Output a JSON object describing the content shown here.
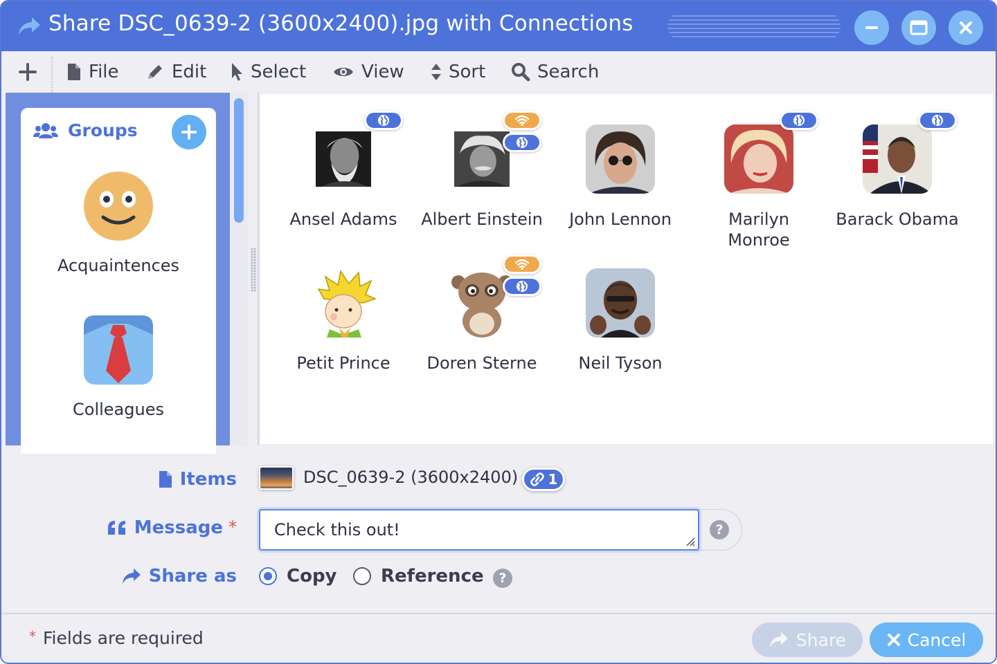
{
  "window": {
    "title": "Share DSC_0639-2 (3600x2400).jpg with Connections"
  },
  "menubar": {
    "items": [
      {
        "label": "File",
        "icon": "file-icon"
      },
      {
        "label": "Edit",
        "icon": "pencil-icon"
      },
      {
        "label": "Select",
        "icon": "pointer-icon"
      },
      {
        "label": "View",
        "icon": "eye-icon"
      },
      {
        "label": "Sort",
        "icon": "sort-icon"
      },
      {
        "label": "Search",
        "icon": "search-icon"
      }
    ]
  },
  "groups": {
    "title": "Groups",
    "items": [
      {
        "label": "Acquaintences",
        "icon": "smiley-face-icon"
      },
      {
        "label": "Colleagues",
        "icon": "shirt-tie-icon"
      }
    ]
  },
  "connections": [
    {
      "name": "Ansel Adams",
      "badges": [
        "globe"
      ]
    },
    {
      "name": "Albert Einstein",
      "badges": [
        "wifi",
        "globe"
      ]
    },
    {
      "name": "John Lennon",
      "badges": []
    },
    {
      "name": "Marilyn Monroe",
      "badges": [
        "globe"
      ]
    },
    {
      "name": "Barack Obama",
      "badges": [
        "globe"
      ]
    },
    {
      "name": "Petit Prince",
      "badges": []
    },
    {
      "name": "Doren Sterne",
      "badges": [
        "wifi",
        "globe"
      ]
    },
    {
      "name": "Neil Tyson",
      "badges": []
    }
  ],
  "form": {
    "items_label": "Items",
    "item_name": "DSC_0639-2 (3600x2400)",
    "link_count": "1",
    "message_label": "Message",
    "required_mark": "*",
    "message_value": "Check this out!",
    "help_glyph": "?",
    "share_as_label": "Share as",
    "share_as_options": [
      "Copy",
      "Reference"
    ],
    "share_as_selected": "Copy"
  },
  "footer": {
    "required_note": "Fields are required",
    "share_label": "Share",
    "cancel_label": "Cancel"
  },
  "colors": {
    "accent": "#4d72d9",
    "sidebar": "#6f8edf",
    "globe_badge": "#4d72d9",
    "wifi_badge": "#f0a84a",
    "cancel_button": "#6bb6f4",
    "share_button_disabled": "#c8d2e6",
    "required": "#e05555"
  }
}
